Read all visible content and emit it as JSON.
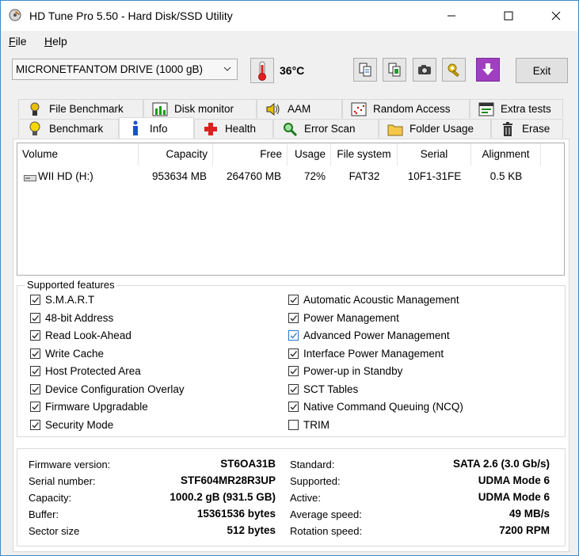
{
  "window": {
    "title": "HD Tune Pro 5.50 - Hard Disk/SSD Utility"
  },
  "menu": {
    "file": "File",
    "help": "Help"
  },
  "toolbar": {
    "drive": "MICRONETFANTOM DRIVE (1000 gB)",
    "temperature": "36°C",
    "exit_label": "Exit"
  },
  "tabs_top": [
    {
      "label": "File Benchmark"
    },
    {
      "label": "Disk monitor"
    },
    {
      "label": "AAM"
    },
    {
      "label": "Random Access"
    },
    {
      "label": "Extra tests"
    }
  ],
  "tabs_bottom": [
    {
      "label": "Benchmark"
    },
    {
      "label": "Info"
    },
    {
      "label": "Health"
    },
    {
      "label": "Error Scan"
    },
    {
      "label": "Folder Usage"
    },
    {
      "label": "Erase"
    }
  ],
  "volumes": {
    "headers": [
      "Volume",
      "Capacity",
      "Free",
      "Usage",
      "File system",
      "Serial",
      "Alignment"
    ],
    "rows": [
      [
        "WII HD (H:)",
        "953634 MB",
        "264760 MB",
        "72%",
        "FAT32",
        "10F1-31FE",
        "0.5 KB"
      ]
    ]
  },
  "features": {
    "title": "Supported features",
    "left": [
      {
        "label": "S.M.A.R.T",
        "checked": true
      },
      {
        "label": "48-bit Address",
        "checked": true
      },
      {
        "label": "Read Look-Ahead",
        "checked": true
      },
      {
        "label": "Write Cache",
        "checked": true
      },
      {
        "label": "Host Protected Area",
        "checked": true
      },
      {
        "label": "Device Configuration Overlay",
        "checked": true
      },
      {
        "label": "Firmware Upgradable",
        "checked": true
      },
      {
        "label": "Security Mode",
        "checked": true
      }
    ],
    "right": [
      {
        "label": "Automatic Acoustic Management",
        "checked": true
      },
      {
        "label": "Power Management",
        "checked": true
      },
      {
        "label": "Advanced Power Management",
        "checked": true
      },
      {
        "label": "Interface Power Management",
        "checked": true
      },
      {
        "label": "Power-up in Standby",
        "checked": true
      },
      {
        "label": "SCT Tables",
        "checked": true
      },
      {
        "label": "Native Command Queuing (NCQ)",
        "checked": true
      },
      {
        "label": "TRIM",
        "checked": false
      }
    ]
  },
  "info": {
    "left": [
      {
        "label": "Firmware version:",
        "value": "ST6OA31B"
      },
      {
        "label": "Serial number:",
        "value": "STF604MR28R3UP"
      },
      {
        "label": "Capacity:",
        "value": "1000.2 gB (931.5 GB)"
      },
      {
        "label": "Buffer:",
        "value": "15361536 bytes"
      },
      {
        "label": "Sector size",
        "value": "512 bytes"
      }
    ],
    "right": [
      {
        "label": "Standard:",
        "value": "SATA 2.6 (3.0 Gb/s)"
      },
      {
        "label": "Supported:",
        "value": "UDMA Mode 6"
      },
      {
        "label": "Active:",
        "value": "UDMA Mode 6"
      },
      {
        "label": "Average speed:",
        "value": "49 MB/s"
      },
      {
        "label": "Rotation speed:",
        "value": "7200 RPM"
      }
    ]
  }
}
